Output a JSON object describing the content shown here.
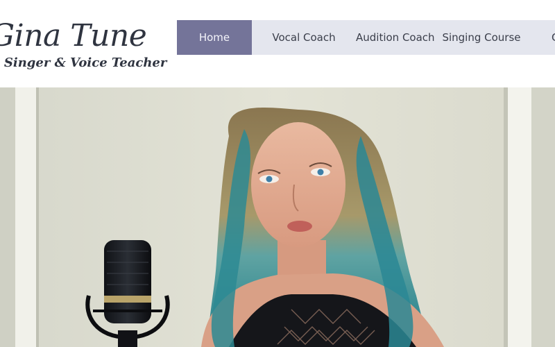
{
  "site": {
    "name": "Gina Tune",
    "tagline": "nal Singer & Voice Teacher"
  },
  "nav": {
    "items": [
      {
        "label": "Home",
        "active": true
      },
      {
        "label": "Vocal Coach",
        "active": false
      },
      {
        "label": "Audition Coach",
        "active": false
      },
      {
        "label": "Singing Course",
        "active": false
      },
      {
        "label": "C",
        "active": false
      }
    ]
  },
  "colors": {
    "nav_background": "#e4e6ee",
    "nav_active": "#747499",
    "brand_text": "#2f3440"
  }
}
